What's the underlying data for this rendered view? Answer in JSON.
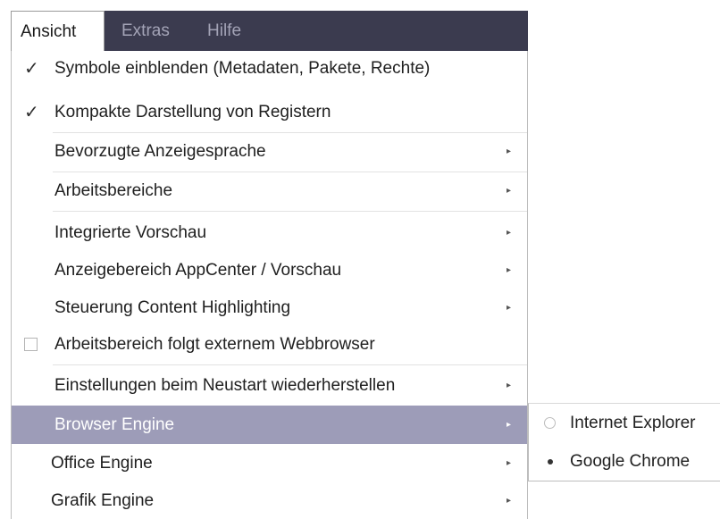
{
  "menubar": {
    "items": [
      {
        "label": "Ansicht"
      },
      {
        "label": "Extras"
      },
      {
        "label": "Hilfe"
      }
    ]
  },
  "dropdown": {
    "items": [
      {
        "label": "Symbole einblenden (Metadaten, Pakete, Rechte)",
        "check": "✓"
      },
      {
        "label": "Kompakte Darstellung von Registern",
        "check": "✓"
      },
      {
        "label": "Bevorzugte Anzeigesprache",
        "arrow": "▸"
      },
      {
        "label": "Arbeitsbereiche",
        "arrow": "▸"
      },
      {
        "label": "Integrierte Vorschau",
        "arrow": "▸"
      },
      {
        "label": "Anzeigebereich AppCenter / Vorschau",
        "arrow": "▸"
      },
      {
        "label": "Steuerung Content Highlighting",
        "arrow": "▸"
      },
      {
        "label": "Arbeitsbereich folgt externem Webbrowser"
      },
      {
        "label": "Einstellungen beim Neustart wiederherstellen",
        "arrow": "▸"
      },
      {
        "label": "Browser Engine",
        "arrow": "▸"
      },
      {
        "label": "Office Engine",
        "arrow": "▸"
      },
      {
        "label": "Grafik Engine",
        "arrow": "▸"
      }
    ]
  },
  "submenu": {
    "items": [
      {
        "label": "Internet Explorer",
        "selected": false
      },
      {
        "label": "Google Chrome",
        "selected": true
      }
    ]
  },
  "colors": {
    "menubar_bg": "#3b3b4f",
    "menubar_inactive_text": "#a3a3b6",
    "highlight_bg": "#9d9cb8"
  }
}
